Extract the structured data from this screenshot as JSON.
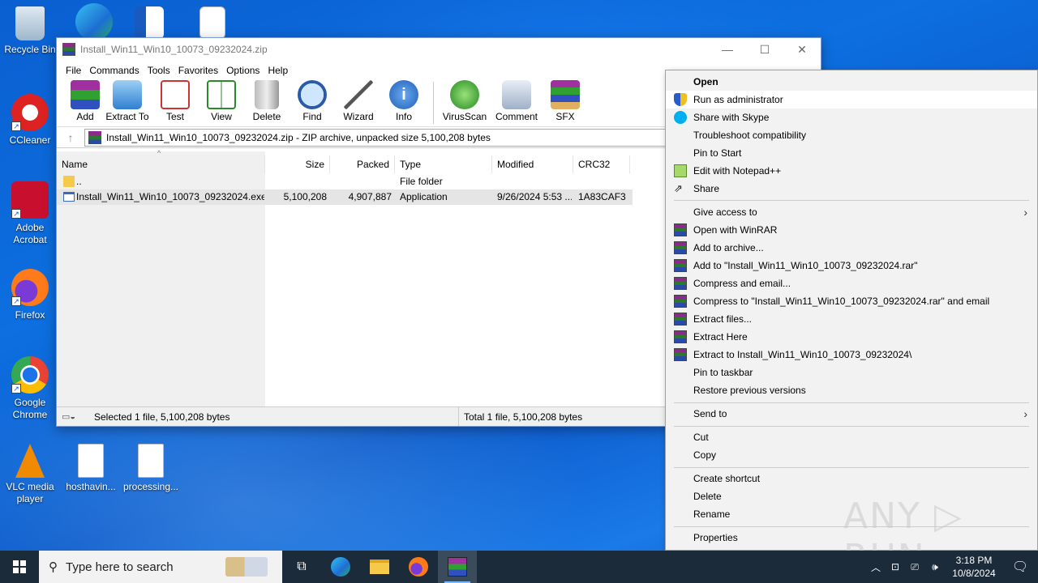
{
  "desktop": {
    "icons": [
      {
        "label": "Recycle Bin"
      },
      {
        "label": "CCleaner"
      },
      {
        "label": "Adobe Acrobat"
      },
      {
        "label": "Firefox"
      },
      {
        "label": "Google Chrome"
      },
      {
        "label": "VLC media player"
      },
      {
        "label": "hosthavin..."
      },
      {
        "label": "processing..."
      }
    ]
  },
  "winrar": {
    "title": "Install_Win11_Win10_10073_09232024.zip",
    "menu": [
      "File",
      "Commands",
      "Tools",
      "Favorites",
      "Options",
      "Help"
    ],
    "toolbar": [
      "Add",
      "Extract To",
      "Test",
      "View",
      "Delete",
      "Find",
      "Wizard",
      "Info",
      "VirusScan",
      "Comment",
      "SFX"
    ],
    "address": "Install_Win11_Win10_10073_09232024.zip - ZIP archive, unpacked size 5,100,208 bytes",
    "columns": [
      "Name",
      "Size",
      "Packed",
      "Type",
      "Modified",
      "CRC32"
    ],
    "rows": [
      {
        "name": "..",
        "size": "",
        "packed": "",
        "type": "File folder",
        "modified": "",
        "crc": ""
      },
      {
        "name": "Install_Win11_Win10_10073_09232024.exe",
        "size": "5,100,208",
        "packed": "4,907,887",
        "type": "Application",
        "modified": "9/26/2024 5:53 ...",
        "crc": "1A83CAF3"
      }
    ],
    "status_left": "Selected 1 file, 5,100,208 bytes",
    "status_right": "Total 1 file, 5,100,208 bytes"
  },
  "context_menu": {
    "items": [
      {
        "label": "Open",
        "bold": true
      },
      {
        "label": "Run as administrator",
        "icon": "shield-icon"
      },
      {
        "label": "Share with Skype",
        "icon": "skype-icon"
      },
      {
        "label": "Troubleshoot compatibility"
      },
      {
        "label": "Pin to Start"
      },
      {
        "label": "Edit with Notepad++",
        "icon": "notepadpp-icon"
      },
      {
        "label": "Share",
        "icon": "share-icon"
      },
      {
        "label": "Give access to",
        "submenu": true
      },
      {
        "label": "Open with WinRAR",
        "icon": "winrar-icon"
      },
      {
        "label": "Add to archive...",
        "icon": "winrar-icon"
      },
      {
        "label": "Add to \"Install_Win11_Win10_10073_09232024.rar\"",
        "icon": "winrar-icon"
      },
      {
        "label": "Compress and email...",
        "icon": "winrar-icon"
      },
      {
        "label": "Compress to \"Install_Win11_Win10_10073_09232024.rar\" and email",
        "icon": "winrar-icon"
      },
      {
        "label": "Extract files...",
        "icon": "winrar-icon"
      },
      {
        "label": "Extract Here",
        "icon": "winrar-icon"
      },
      {
        "label": "Extract to Install_Win11_Win10_10073_09232024\\",
        "icon": "winrar-icon"
      },
      {
        "label": "Pin to taskbar"
      },
      {
        "label": "Restore previous versions"
      },
      {
        "label": "Send to",
        "submenu": true
      },
      {
        "label": "Cut"
      },
      {
        "label": "Copy"
      },
      {
        "label": "Create shortcut"
      },
      {
        "label": "Delete"
      },
      {
        "label": "Rename"
      },
      {
        "label": "Properties"
      }
    ]
  },
  "watermark": "ANY ▷ RUN",
  "taskbar": {
    "search_placeholder": "Type here to search",
    "time": "3:18 PM",
    "date": "10/8/2024"
  }
}
